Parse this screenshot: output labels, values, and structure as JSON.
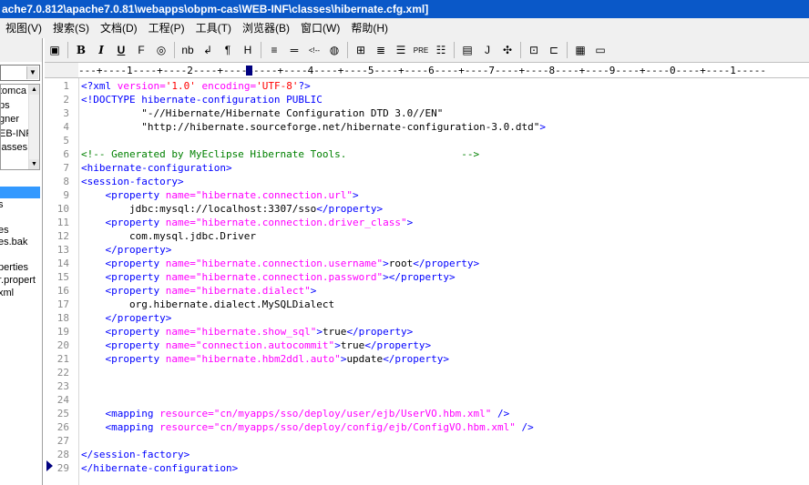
{
  "window": {
    "title": "ache7.0.812\\apache7.0.81\\webapps\\obpm-cas\\WEB-INF\\classes\\hibernate.cfg.xml]"
  },
  "menu": [
    {
      "label": "视图(V)"
    },
    {
      "label": "搜索(S)"
    },
    {
      "label": "文档(D)"
    },
    {
      "label": "工程(P)"
    },
    {
      "label": "工具(T)"
    },
    {
      "label": "浏览器(B)"
    },
    {
      "label": "窗口(W)"
    },
    {
      "label": "帮助(H)"
    }
  ],
  "toolbar": {
    "buttons": [
      {
        "name": "page-icon",
        "glyph": "▣"
      },
      {
        "name": "bold-button",
        "glyph": "B"
      },
      {
        "name": "italic-button",
        "glyph": "I"
      },
      {
        "name": "underline-button",
        "glyph": "U"
      },
      {
        "name": "font-button",
        "glyph": "F"
      },
      {
        "name": "color-icon",
        "glyph": "◎"
      },
      {
        "name": "nbsp-button",
        "glyph": "nb"
      },
      {
        "name": "linebreak-button",
        "glyph": "↲"
      },
      {
        "name": "paragraph-button",
        "glyph": "¶"
      },
      {
        "name": "heading-button",
        "glyph": "H"
      },
      {
        "name": "align-left-icon",
        "glyph": "≡"
      },
      {
        "name": "hr-icon",
        "glyph": "═"
      },
      {
        "name": "comment-icon",
        "glyph": "<!--"
      },
      {
        "name": "image-icon",
        "glyph": "◍"
      },
      {
        "name": "table-icon",
        "glyph": "⊞"
      },
      {
        "name": "center-icon",
        "glyph": "≣"
      },
      {
        "name": "justify-icon",
        "glyph": "☰"
      },
      {
        "name": "pre-button",
        "glyph": "PRE"
      },
      {
        "name": "list-icon",
        "glyph": "☷"
      },
      {
        "name": "script-icon",
        "glyph": "▤"
      },
      {
        "name": "j-button",
        "glyph": "J"
      },
      {
        "name": "plugin-icon",
        "glyph": "✣"
      },
      {
        "name": "snippet-icon",
        "glyph": "⊡"
      },
      {
        "name": "clip-icon",
        "glyph": "⊏"
      },
      {
        "name": "color-grid-icon",
        "glyph": "▦"
      },
      {
        "name": "window-icon",
        "glyph": "▭"
      }
    ]
  },
  "ruler": {
    "text": "---+----1----+----2----+----3----+----4----+----5----+----6----+----7----+----8----+----9----+----0----+----1-----"
  },
  "sidebar": {
    "tree_items": [
      "tomca",
      "ps",
      "gner",
      "EB-INF",
      "lasses"
    ],
    "files": [
      "s",
      "",
      "es",
      "es.bak",
      "",
      "perties",
      "r.propert",
      "xml"
    ]
  },
  "editor": {
    "lines": [
      {
        "n": "1",
        "segs": [
          [
            "tag",
            "<?xml "
          ],
          [
            "attr",
            "version="
          ],
          [
            "dq",
            "'1.0'"
          ],
          [
            "attr",
            " encoding="
          ],
          [
            "dq",
            "'UTF-8'"
          ],
          [
            "tag",
            "?>"
          ]
        ]
      },
      {
        "n": "2",
        "segs": [
          [
            "tag",
            "<!DOCTYPE hibernate-configuration PUBLIC"
          ]
        ]
      },
      {
        "n": "3",
        "segs": [
          [
            "str",
            "          \"-//Hibernate/Hibernate Configuration DTD 3.0//EN\""
          ]
        ]
      },
      {
        "n": "4",
        "segs": [
          [
            "str",
            "          \"http://hibernate.sourceforge.net/hibernate-configuration-3.0.dtd\""
          ],
          [
            "tag",
            ">"
          ]
        ]
      },
      {
        "n": "5",
        "segs": [
          [
            "txt",
            ""
          ]
        ]
      },
      {
        "n": "6",
        "segs": [
          [
            "cmt",
            "<!-- Generated by MyEclipse Hibernate Tools.                   -->"
          ]
        ]
      },
      {
        "n": "7",
        "segs": [
          [
            "tag",
            "<hibernate-configuration>"
          ]
        ]
      },
      {
        "n": "8",
        "segs": [
          [
            "tag",
            "<session-factory>"
          ]
        ]
      },
      {
        "n": "9",
        "segs": [
          [
            "txt",
            "    "
          ],
          [
            "tag",
            "<property "
          ],
          [
            "attr",
            "name="
          ],
          [
            "val",
            "\"hibernate.connection.url\""
          ],
          [
            "tag",
            ">"
          ]
        ]
      },
      {
        "n": "10",
        "segs": [
          [
            "txt",
            "        jdbc:mysql://localhost:3307/sso"
          ],
          [
            "tag",
            "</property>"
          ]
        ]
      },
      {
        "n": "11",
        "segs": [
          [
            "txt",
            "    "
          ],
          [
            "tag",
            "<property "
          ],
          [
            "attr",
            "name="
          ],
          [
            "val",
            "\"hibernate.connection.driver_class\""
          ],
          [
            "tag",
            ">"
          ]
        ]
      },
      {
        "n": "12",
        "segs": [
          [
            "txt",
            "        com.mysql.jdbc.Driver"
          ]
        ]
      },
      {
        "n": "13",
        "segs": [
          [
            "txt",
            "    "
          ],
          [
            "tag",
            "</property>"
          ]
        ]
      },
      {
        "n": "14",
        "segs": [
          [
            "txt",
            "    "
          ],
          [
            "tag",
            "<property "
          ],
          [
            "attr",
            "name="
          ],
          [
            "val",
            "\"hibernate.connection.username\""
          ],
          [
            "tag",
            ">"
          ],
          [
            "txt",
            "root"
          ],
          [
            "tag",
            "</property>"
          ]
        ]
      },
      {
        "n": "15",
        "segs": [
          [
            "txt",
            "    "
          ],
          [
            "tag",
            "<property "
          ],
          [
            "attr",
            "name="
          ],
          [
            "val",
            "\"hibernate.connection.password\""
          ],
          [
            "tag",
            "></property>"
          ]
        ]
      },
      {
        "n": "16",
        "segs": [
          [
            "txt",
            "    "
          ],
          [
            "tag",
            "<property "
          ],
          [
            "attr",
            "name="
          ],
          [
            "val",
            "\"hibernate.dialect\""
          ],
          [
            "tag",
            ">"
          ]
        ]
      },
      {
        "n": "17",
        "segs": [
          [
            "txt",
            "        org.hibernate.dialect.MySQLDialect"
          ]
        ]
      },
      {
        "n": "18",
        "segs": [
          [
            "txt",
            "    "
          ],
          [
            "tag",
            "</property>"
          ]
        ]
      },
      {
        "n": "19",
        "segs": [
          [
            "txt",
            "    "
          ],
          [
            "tag",
            "<property "
          ],
          [
            "attr",
            "name="
          ],
          [
            "val",
            "\"hibernate.show_sql\""
          ],
          [
            "tag",
            ">"
          ],
          [
            "txt",
            "true"
          ],
          [
            "tag",
            "</property>"
          ]
        ]
      },
      {
        "n": "20",
        "segs": [
          [
            "txt",
            "    "
          ],
          [
            "tag",
            "<property "
          ],
          [
            "attr",
            "name="
          ],
          [
            "val",
            "\"connection.autocommit\""
          ],
          [
            "tag",
            ">"
          ],
          [
            "txt",
            "true"
          ],
          [
            "tag",
            "</property>"
          ]
        ]
      },
      {
        "n": "21",
        "segs": [
          [
            "txt",
            "    "
          ],
          [
            "tag",
            "<property "
          ],
          [
            "attr",
            "name="
          ],
          [
            "val",
            "\"hibernate.hbm2ddl.auto\""
          ],
          [
            "tag",
            ">"
          ],
          [
            "txt",
            "update"
          ],
          [
            "tag",
            "</property>"
          ]
        ]
      },
      {
        "n": "22",
        "segs": [
          [
            "txt",
            ""
          ]
        ]
      },
      {
        "n": "23",
        "segs": [
          [
            "txt",
            ""
          ]
        ]
      },
      {
        "n": "24",
        "segs": [
          [
            "txt",
            ""
          ]
        ]
      },
      {
        "n": "25",
        "segs": [
          [
            "txt",
            "    "
          ],
          [
            "tag",
            "<mapping "
          ],
          [
            "attr",
            "resource="
          ],
          [
            "val",
            "\"cn/myapps/sso/deploy/user/ejb/UserVO.hbm.xml\""
          ],
          [
            "tag",
            " />"
          ]
        ]
      },
      {
        "n": "26",
        "segs": [
          [
            "txt",
            "    "
          ],
          [
            "tag",
            "<mapping "
          ],
          [
            "attr",
            "resource="
          ],
          [
            "val",
            "\"cn/myapps/sso/deploy/config/ejb/ConfigVO.hbm.xml\""
          ],
          [
            "tag",
            " />"
          ]
        ]
      },
      {
        "n": "27",
        "segs": [
          [
            "txt",
            ""
          ]
        ]
      },
      {
        "n": "28",
        "segs": [
          [
            "tag",
            "</session-factory>"
          ]
        ]
      },
      {
        "n": "29",
        "segs": [
          [
            "tag",
            "</hibernate-configuration>"
          ]
        ]
      }
    ]
  },
  "colors": {
    "titlebar": "#0a58c8",
    "tag": "#0000ff",
    "attribute": "#ff00ff",
    "comment": "#008000",
    "selection": "#3399ff"
  }
}
